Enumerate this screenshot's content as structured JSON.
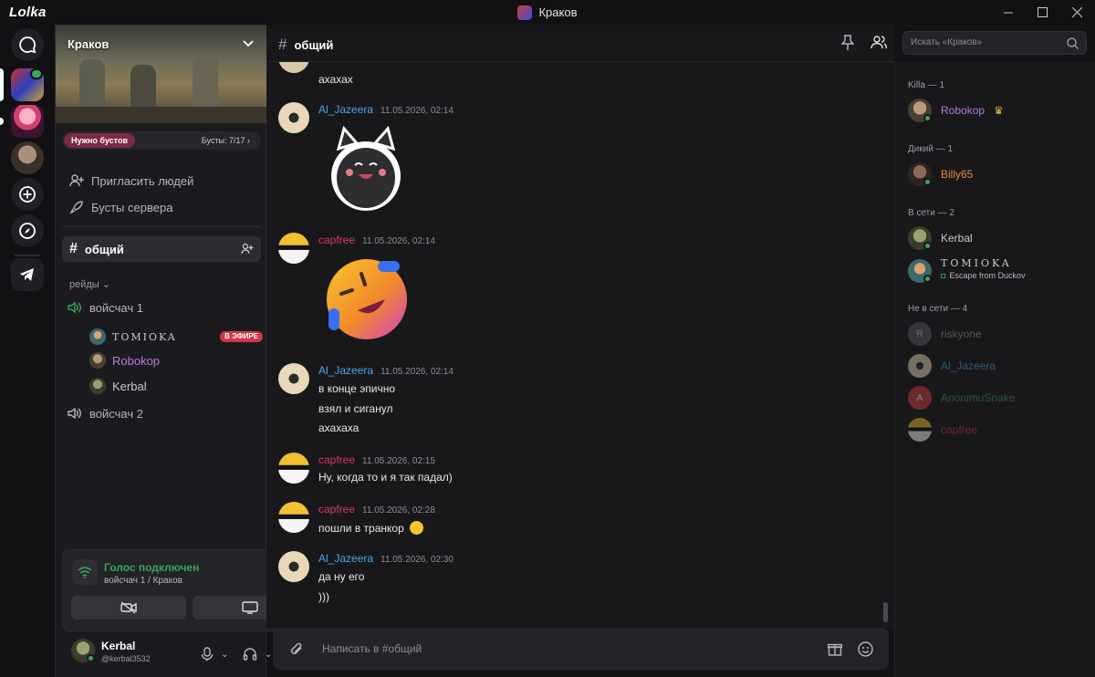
{
  "app": {
    "name": "Lolka",
    "window_title": "Краков"
  },
  "server": {
    "name": "Краков",
    "boost_label": "Нужно бустов",
    "boost_count": "Бусты: 7/17",
    "invite": "Пригласить людей",
    "boosts": "Бусты сервера",
    "active_channel": "общий",
    "category": "рейды",
    "voice_channels": [
      {
        "name": "войсчач 1",
        "users": [
          {
            "name": "TOMIOKA",
            "live": "В ЭФИРЕ",
            "color": "#c9c9cc"
          },
          {
            "name": "Robokop",
            "color": "#b57ad8"
          },
          {
            "name": "Kerbal",
            "color": "#c9c9cc"
          }
        ]
      },
      {
        "name": "войсчач 2"
      }
    ]
  },
  "voice_panel": {
    "title": "Голос подключен",
    "subtitle": "войсчач 1 / Краков"
  },
  "user": {
    "name": "Kerbal",
    "tag": "@kerbal3532"
  },
  "chat": {
    "channel": "общий",
    "composer_placeholder": "Написать в #общий",
    "cut_line": "ахахах",
    "messages": [
      {
        "author": "Al_Jazeera",
        "color": "#4aa3e8",
        "time": "11.05.2026, 02:14",
        "lines": []
      },
      {
        "author": "capfree",
        "color": "#d2376b",
        "time": "11.05.2026, 02:14",
        "lines": []
      },
      {
        "author": "Al_Jazeera",
        "color": "#4aa3e8",
        "time": "11.05.2026, 02:14",
        "lines": [
          "в конце эпично",
          "взял и сиганул",
          "ахахаха"
        ]
      },
      {
        "author": "capfree",
        "color": "#d2376b",
        "time": "11.05.2026, 02:15",
        "lines": [
          "Ну, когда то и я так падал)"
        ]
      },
      {
        "author": "capfree",
        "color": "#d2376b",
        "time": "11.05.2026, 02:28",
        "lines": [
          "пошли в транкор"
        ]
      },
      {
        "author": "Al_Jazeera",
        "color": "#4aa3e8",
        "time": "11.05.2026, 02:30",
        "lines": [
          "да ну его",
          ")))"
        ]
      }
    ]
  },
  "search": {
    "placeholder": "Искать «Краков»"
  },
  "members": {
    "groups": [
      {
        "title": "Killa — 1",
        "members": [
          {
            "name": "Robokop",
            "color": "#b57ad8"
          }
        ]
      },
      {
        "title": "Дикий — 1",
        "members": [
          {
            "name": "Billy65",
            "color": "#e08a3c"
          }
        ]
      },
      {
        "title": "В сети — 2",
        "members": [
          {
            "name": "Kerbal",
            "color": "#c9c9cc"
          },
          {
            "name": "TOMIOKA",
            "color": "#c9c9cc",
            "activity": "Escape from Duckov"
          }
        ]
      },
      {
        "title": "Не в сети — 4",
        "members": [
          {
            "name": "riskyone",
            "color": "#9a9ba1"
          },
          {
            "name": "Al_Jazeera",
            "color": "#4aa3e8"
          },
          {
            "name": "AnonimuSnake",
            "color": "#3ba55d"
          },
          {
            "name": "capfree",
            "color": "#d2376b"
          }
        ]
      }
    ]
  }
}
